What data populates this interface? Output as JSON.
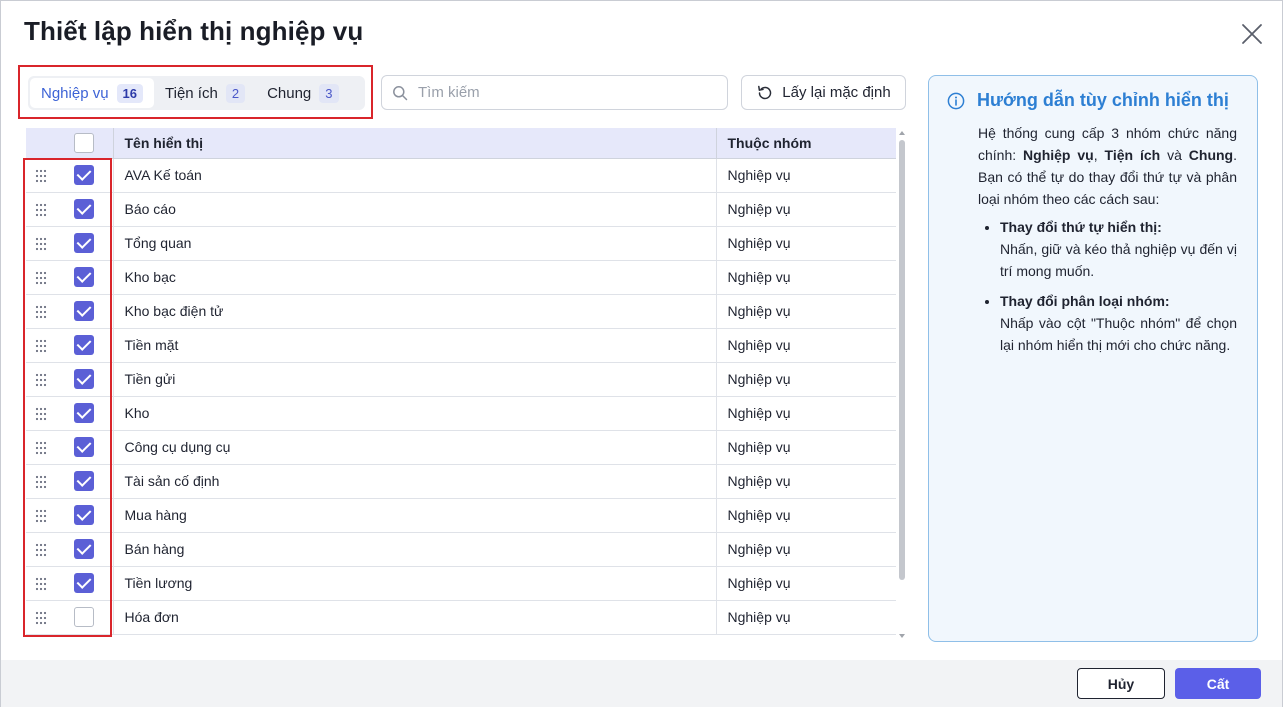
{
  "dialog": {
    "title": "Thiết lập hiển thị nghiệp vụ",
    "close_icon": "close-icon"
  },
  "tabs": [
    {
      "label": "Nghiệp vụ",
      "count": "16",
      "active": true
    },
    {
      "label": "Tiện ích",
      "count": "2",
      "active": false
    },
    {
      "label": "Chung",
      "count": "3",
      "active": false
    }
  ],
  "search": {
    "placeholder": "Tìm kiếm",
    "value": "",
    "icon": "search-icon"
  },
  "reset_button": {
    "label": "Lấy lại mặc định",
    "icon": "reset-icon"
  },
  "table": {
    "headers": {
      "select_all_checked": false,
      "name": "Tên hiển thị",
      "group": "Thuộc nhóm"
    },
    "rows": [
      {
        "name": "AVA Kế toán",
        "group": "Nghiệp vụ",
        "checked": true
      },
      {
        "name": "Báo cáo",
        "group": "Nghiệp vụ",
        "checked": true
      },
      {
        "name": "Tổng quan",
        "group": "Nghiệp vụ",
        "checked": true
      },
      {
        "name": "Kho bạc",
        "group": "Nghiệp vụ",
        "checked": true
      },
      {
        "name": "Kho bạc điện tử",
        "group": "Nghiệp vụ",
        "checked": true
      },
      {
        "name": "Tiền mặt",
        "group": "Nghiệp vụ",
        "checked": true
      },
      {
        "name": "Tiền gửi",
        "group": "Nghiệp vụ",
        "checked": true
      },
      {
        "name": "Kho",
        "group": "Nghiệp vụ",
        "checked": true
      },
      {
        "name": "Công cụ dụng cụ",
        "group": "Nghiệp vụ",
        "checked": true
      },
      {
        "name": "Tài sản cố định",
        "group": "Nghiệp vụ",
        "checked": true
      },
      {
        "name": "Mua hàng",
        "group": "Nghiệp vụ",
        "checked": true
      },
      {
        "name": "Bán hàng",
        "group": "Nghiệp vụ",
        "checked": true
      },
      {
        "name": "Tiền lương",
        "group": "Nghiệp vụ",
        "checked": true
      },
      {
        "name": "Hóa đơn",
        "group": "Nghiệp vụ",
        "checked": false
      }
    ]
  },
  "help": {
    "title": "Hướng dẫn tùy chỉnh hiển thị",
    "icon": "info-icon",
    "intro_1": "Hệ thống cung cấp 3 nhóm chức năng chính: ",
    "intro_g1": "Nghiệp vụ",
    "intro_sep1": ", ",
    "intro_g2": "Tiện ích",
    "intro_sep2": " và ",
    "intro_g3": "Chung",
    "intro_2": ". Bạn có thể tự do thay đổi thứ tự và phân loại nhóm theo các cách sau:",
    "items": [
      {
        "title": "Thay đổi thứ tự hiển thị:",
        "text": "Nhấn, giữ và kéo thả nghiệp vụ đến vị trí mong muốn."
      },
      {
        "title": "Thay đổi phân loại nhóm:",
        "text": "Nhấp vào cột \"Thuộc nhóm\" để chọn lại nhóm hiển thị mới cho chức năng."
      }
    ]
  },
  "footer": {
    "cancel_label": "Hủy",
    "save_label": "Cất"
  },
  "colors": {
    "accent": "#5b5fe8",
    "highlight": "#d9252b",
    "help_title": "#2d7fd3"
  }
}
